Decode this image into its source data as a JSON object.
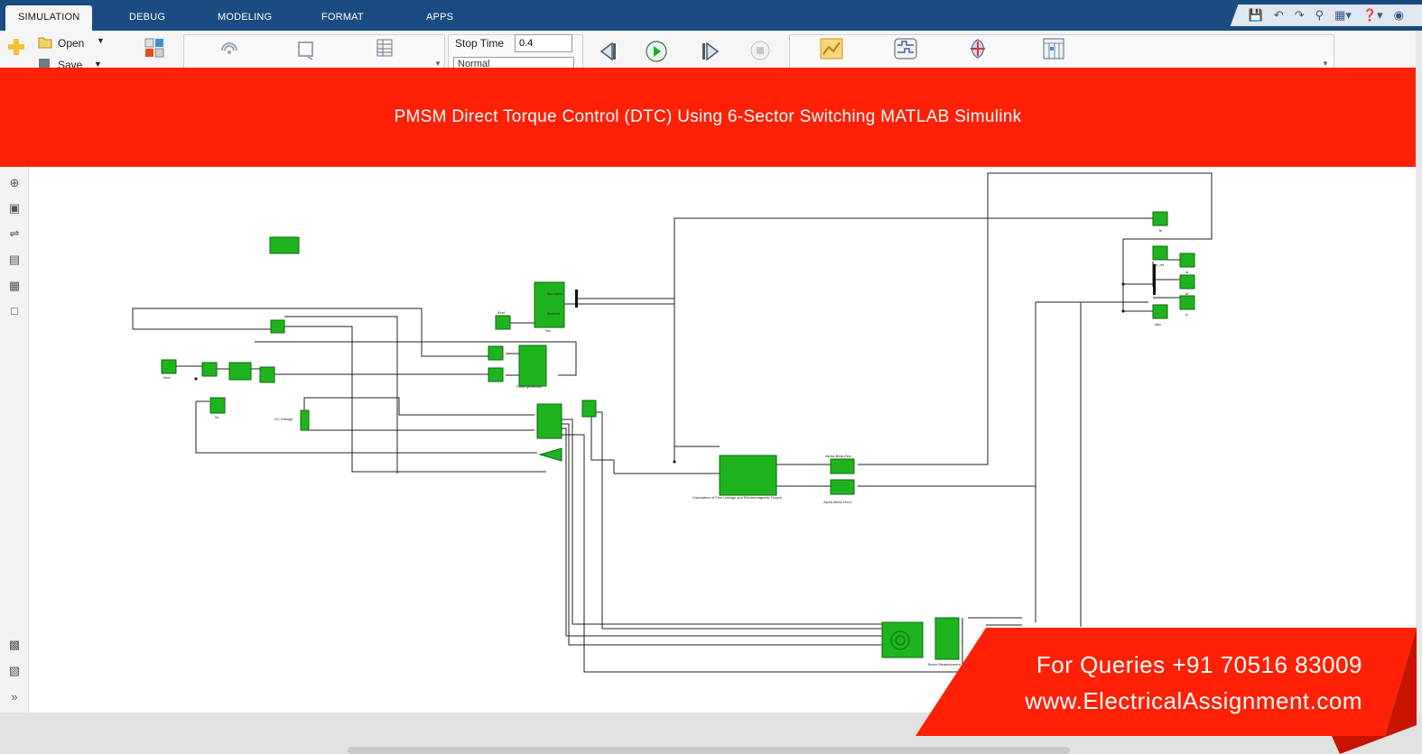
{
  "tabs": [
    "SIMULATION",
    "DEBUG",
    "MODELING",
    "FORMAT",
    "APPS"
  ],
  "toolstrip": {
    "open_label": "Open",
    "save_label": "Save",
    "stop_time_label": "Stop Time",
    "stop_time_value": "0.4",
    "mode_value": "Normal"
  },
  "banner": {
    "title": "PMSM Direct Torque Control (DTC) Using 6-Sector Switching  MATLAB Simulink"
  },
  "contact": {
    "phone": "For Queries +91 70516 83009",
    "website": "www.ElectricalAssignment.com"
  },
  "diagram": {
    "labels": {
      "nref": "Nref",
      "nr": "Nr",
      "dc_voltage": "DC Voltage",
      "psiref": "Ψref",
      "sw": "Sw",
      "pulse_gen": "Pulse generator",
      "calc": "Calculation of Flux Linkage and Electromagnetic Torque",
      "abc1": "Alpha-Beta-Zero",
      "abc2": "Alpha-Beta-Zero1",
      "motor": "Motor Measurement",
      "te": "Te",
      "te_ref": "Te_ref",
      "ia": "ia",
      "ib": "ib",
      "ic": "ic",
      "iabc": "iabc",
      "flux_alpha": "flux-alpha",
      "fluxbeta": "fluxbeta"
    }
  },
  "colors": {
    "tab_bar": "#1a4c82",
    "banner": "#ff2006",
    "block_fill": "#1fb41f",
    "block_edge": "#0a6a0a"
  }
}
